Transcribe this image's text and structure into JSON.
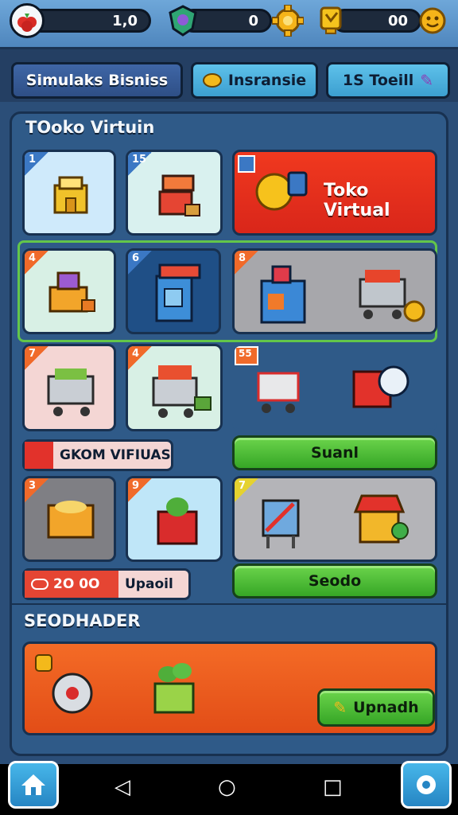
{
  "resources": {
    "coins": "1,0",
    "gems": "0",
    "energy": "00"
  },
  "tabs": [
    {
      "label": "Simulaks Bisniss"
    },
    {
      "label": "Insransie"
    },
    {
      "label": "1S Toeill"
    }
  ],
  "panel": {
    "title": "TOoko Virtuin",
    "cards": [
      {
        "num": "1"
      },
      {
        "num": "15"
      },
      {
        "num": "4"
      },
      {
        "num": "6"
      },
      {
        "num": "8"
      },
      {
        "num": "7"
      },
      {
        "num": "4"
      },
      {
        "num": "55"
      },
      {
        "num": "3"
      },
      {
        "num": "9"
      },
      {
        "num": "7"
      }
    ],
    "featured_title": "Toko Virtual",
    "promo_label": "GKOM VIFIUAS",
    "price_label": "2O 0O",
    "upgrade_label": "Upaoil",
    "btn_1": "Suanl",
    "btn_2": "Seodo"
  },
  "section": {
    "title": "SEODHADER",
    "upgrade_button": "Upnadh"
  },
  "icons": {
    "coin": "berry-icon",
    "gem": "shield-gem-icon",
    "energy": "trophy-icon",
    "home": "home-icon",
    "settings": "settings-icon"
  },
  "colors": {
    "accent_red": "#e8321f",
    "accent_orange": "#f25a1c",
    "green_button": "#3aaa2a",
    "panel_blue": "#2f5a88"
  }
}
